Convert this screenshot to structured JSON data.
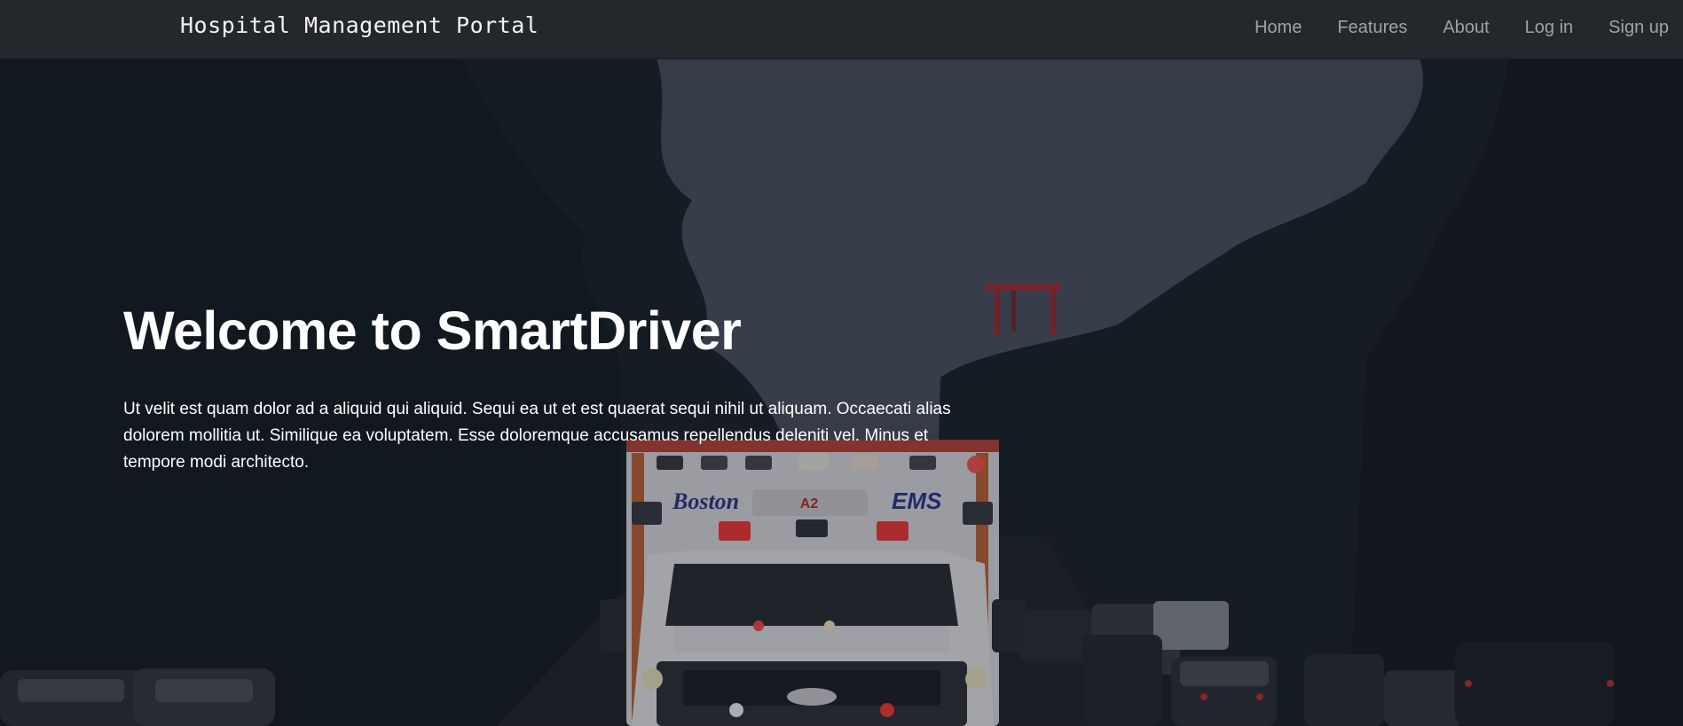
{
  "navbar": {
    "brand": "Hospital Management Portal",
    "links": [
      {
        "label": "Home"
      },
      {
        "label": "Features"
      },
      {
        "label": "About"
      },
      {
        "label": "Log in"
      },
      {
        "label": "Sign up"
      }
    ]
  },
  "hero": {
    "title": "Welcome to SmartDriver",
    "text": "Ut velit est quam dolor ad a aliquid qui aliquid. Sequi ea ut et est quaerat sequi nihil ut aliquam. Occaecati alias dolorem mollitia ut. Similique ea voluptatem. Esse doloremque accusamus repellendus deleniti vel. Minus et tempore modi architecto.",
    "background_image": {
      "ambulance_text_left": "Boston",
      "ambulance_text_center": "A2",
      "ambulance_text_right": "EMS"
    }
  },
  "colors": {
    "navbar_bg": "#24272b",
    "nav_link": "#9fa3a7",
    "brand_text": "#f3f3f3",
    "hero_text": "#ffffff",
    "ambulance_accent": "#2b3a8f"
  }
}
